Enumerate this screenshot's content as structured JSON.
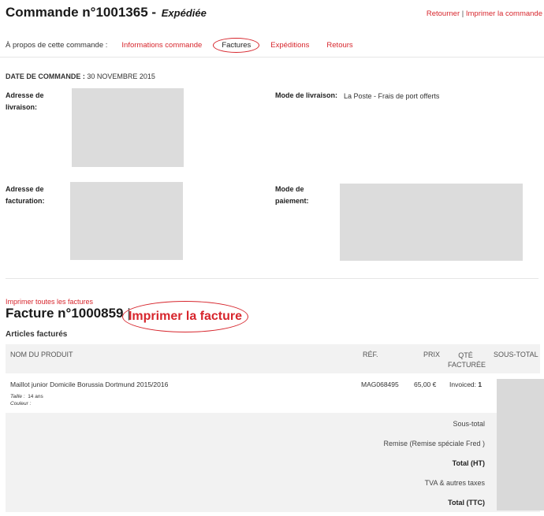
{
  "header": {
    "title": "Commande n°1001365 - ",
    "status": "Expédiée",
    "return_link": "Retourner",
    "separator": " | ",
    "print_order_link": "Imprimer la commande"
  },
  "about": {
    "label": "À propos de cette commande :",
    "tabs": [
      {
        "label": "Informations commande"
      },
      {
        "label": "Factures"
      },
      {
        "label": "Expéditions"
      },
      {
        "label": "Retours"
      }
    ]
  },
  "order_date": {
    "label": "DATE DE COMMANDE :",
    "value": "30 NOVEMBRE 2015"
  },
  "fields": {
    "shipping_address_label_1": "Adresse de",
    "shipping_address_label_2": "livraison:",
    "shipping_method_label": "Mode de livraison:",
    "shipping_method_value": "La Poste - Frais de port offerts",
    "billing_address_label_1": "Adresse de",
    "billing_address_label_2": "facturation:",
    "payment_method_label_1": "Mode de",
    "payment_method_label_2": "paiement:"
  },
  "invoice": {
    "print_all": "Imprimer toutes les factures",
    "title": "Facture n°1000859",
    "separator": "|",
    "print_invoice": "Imprimer la facture",
    "items_heading": "Articles facturés"
  },
  "table": {
    "headers": {
      "product": "NOM DU PRODUIT",
      "ref": "RÉF.",
      "price": "PRIX",
      "qty_1": "QTÉ",
      "qty_2": "FACTURÉE",
      "subtotal": "SOUS-TOTAL"
    },
    "rows": [
      {
        "product": "Maillot junior Domicile Borussia Dortmund 2015/2016",
        "size_label": "Taille :",
        "size_value": "14 ans",
        "color_label": "Couleur :",
        "color_value": "",
        "ref": "MAG068495",
        "price": "65,00 €",
        "qty_label": "Invoiced:",
        "qty_value": "1"
      }
    ]
  },
  "totals": {
    "subtotal": "Sous-total",
    "discount": "Remise (Remise spéciale Fred )",
    "total_ht": "Total (HT)",
    "vat": "TVA & autres taxes",
    "total_ttc": "Total (TTC)"
  }
}
